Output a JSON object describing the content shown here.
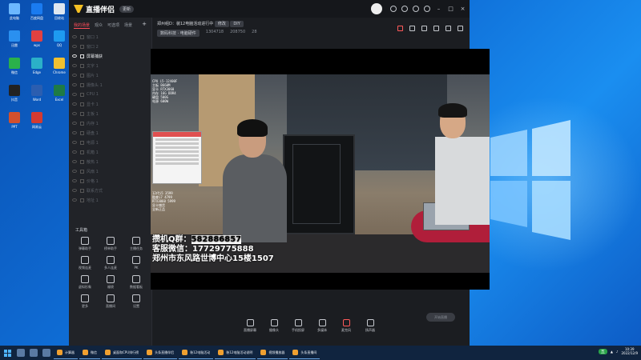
{
  "desktop": {
    "icons": [
      {
        "label": "此电脑",
        "color": "#6cb8ff"
      },
      {
        "label": "百度网盘",
        "color": "#1a7bf0"
      },
      {
        "label": "回收站",
        "color": "#dfe7f0"
      },
      {
        "label": "迅雷",
        "color": "#2a90f0"
      },
      {
        "label": "wps",
        "color": "#e14141"
      },
      {
        "label": "QQ",
        "color": "#1e9bf0"
      },
      {
        "label": "微信",
        "color": "#2ab14a"
      },
      {
        "label": "Edge",
        "color": "#2bb0c8"
      },
      {
        "label": "Chrome",
        "color": "#f0c030"
      },
      {
        "label": "抖音",
        "color": "#222222"
      },
      {
        "label": "Word",
        "color": "#2b5eb0"
      },
      {
        "label": "Excel",
        "color": "#1e7b45"
      },
      {
        "label": "PPT",
        "color": "#d2502d"
      },
      {
        "label": "网易云",
        "color": "#d33a31"
      }
    ]
  },
  "app": {
    "name": "直播伴侣",
    "badge": "更新",
    "left_tabs": [
      "我的场景",
      "观众",
      "可选项",
      "场景"
    ],
    "sources": [
      {
        "label": "窗口 1",
        "on": false
      },
      {
        "label": "窗口 2",
        "on": false
      },
      {
        "label": "屏幕捕获",
        "on": true
      },
      {
        "label": "文字 1",
        "on": false
      },
      {
        "label": "图片 1",
        "on": false
      },
      {
        "label": "摄像头 1",
        "on": false
      },
      {
        "label": "CPU 1",
        "on": false
      },
      {
        "label": "显卡 1",
        "on": false
      },
      {
        "label": "主板 1",
        "on": false
      },
      {
        "label": "内存 1",
        "on": false
      },
      {
        "label": "硬盘 1",
        "on": false
      },
      {
        "label": "电源 1",
        "on": false
      },
      {
        "label": "机箱 1",
        "on": false
      },
      {
        "label": "散热 1",
        "on": false
      },
      {
        "label": "风扇 1",
        "on": false
      },
      {
        "label": "价格 1",
        "on": false
      },
      {
        "label": "联系方式",
        "on": false
      },
      {
        "label": "地址 1",
        "on": false
      }
    ],
    "tools_title": "工具箱",
    "tools": [
      "弹幕助手",
      "榜单助手",
      "主播任务",
      "视频连麦",
      "多人连麦",
      "PK",
      "虚拟形象",
      "福袋",
      "数据看板",
      "更多",
      "直播间",
      "设置"
    ],
    "left_footer": "头条直播伴侣使用说明",
    "stream": {
      "title": "郑州组D：装12电脑活动进行中",
      "edit": "修改",
      "category": "DIY",
      "chip": "数码科技 · 电脑硬件",
      "views": "1304718",
      "likes": "208750",
      "fans": "28"
    },
    "controls": [
      "直播屏幕",
      "摄像头",
      "手机投屏",
      "多媒体",
      "麦克风",
      "扬声器"
    ],
    "go_live": "开始直播"
  },
  "video": {
    "overlay_table": [
      "CPU  i5-12400F",
      "主板  B660M",
      "显卡  RTX3060",
      "内存  16G DDR4",
      "硬盘  500G",
      "电源  600W"
    ],
    "overlay_list": [
      "12代i5  3599",
      "酷睿i7  4799",
      "RTX3060  5999",
      "显卡铺货",
      "全新正品"
    ],
    "contact": {
      "qq_label": "攒机Q群",
      "qq": "582886857",
      "wechat_label": "客服微信",
      "wechat": "17729775888",
      "address": "郑州市东风路世博中心15楼1507"
    }
  },
  "taskbar": {
    "tasks": [
      "计算器",
      "微信",
      "桌面和CPU排行榜",
      "头条直播伴侣",
      "装12电脑活动",
      "装12电脑活动说明",
      "视频播放器",
      "头条直播间"
    ],
    "ime": "五",
    "time": "10:39",
    "date": "2022/12/9"
  }
}
